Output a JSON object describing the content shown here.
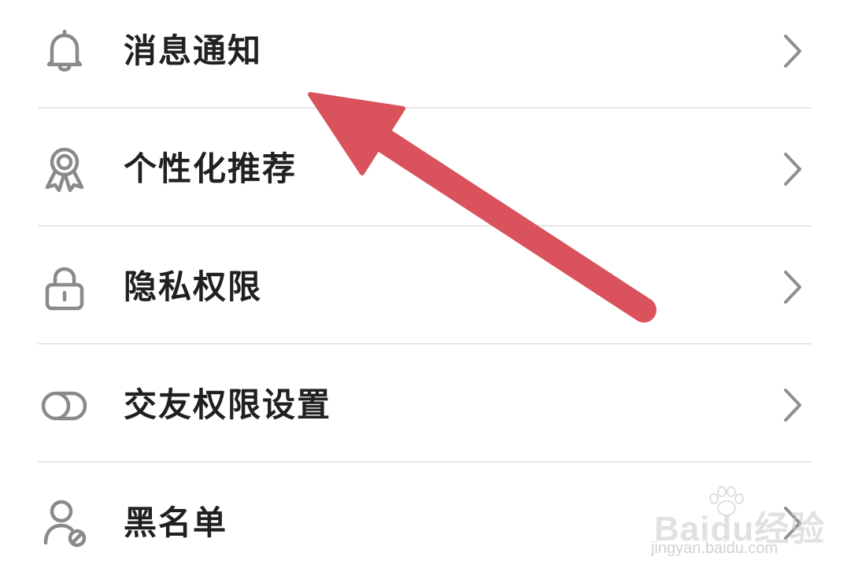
{
  "menu": {
    "items": [
      {
        "label": "消息通知",
        "icon": "bell-icon"
      },
      {
        "label": "个性化推荐",
        "icon": "award-ribbon-icon"
      },
      {
        "label": "隐私权限",
        "icon": "lock-icon"
      },
      {
        "label": "交友权限设置",
        "icon": "toggle-circles-icon"
      },
      {
        "label": "黑名单",
        "icon": "user-blocked-icon"
      }
    ],
    "chevron_icon": "chevron-right-icon"
  },
  "annotation": {
    "icon": "red-arrow-icon",
    "color": "#d9525c"
  },
  "watermark": {
    "brand": "Baidu经验",
    "url": "jingyan.baidu.com"
  },
  "colors": {
    "text": "#202020",
    "icon": "#8a8a8a",
    "chevron": "#8f8f8f",
    "divider": "#e6e6e6",
    "background": "#ffffff"
  }
}
